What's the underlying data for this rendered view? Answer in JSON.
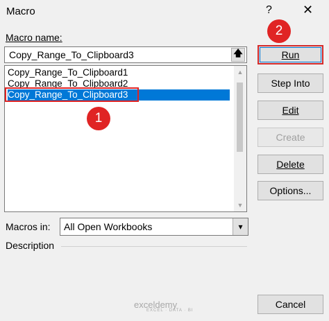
{
  "window": {
    "title": "Macro",
    "help": "?",
    "close": "✕"
  },
  "macro_name": {
    "label": "Macro name:",
    "value": "Copy_Range_To_Clipboard3"
  },
  "macro_list": [
    "Copy_Range_To_Clipboard1",
    "Copy_Range_To_Clipboard2",
    "Copy_Range_To_Clipboard3"
  ],
  "selected_index": 2,
  "buttons": {
    "run": "Run",
    "step_into": "Step Into",
    "edit": "Edit",
    "create": "Create",
    "delete": "Delete",
    "options": "Options...",
    "cancel": "Cancel"
  },
  "macros_in": {
    "label": "Macros in:",
    "value": "All Open Workbooks"
  },
  "description": {
    "label": "Description"
  },
  "annotations": {
    "badge1": "1",
    "badge2": "2",
    "color": "#e02424"
  },
  "watermark": {
    "brand": "exceldemy",
    "tagline": "EXCEL · DATA · BI"
  }
}
